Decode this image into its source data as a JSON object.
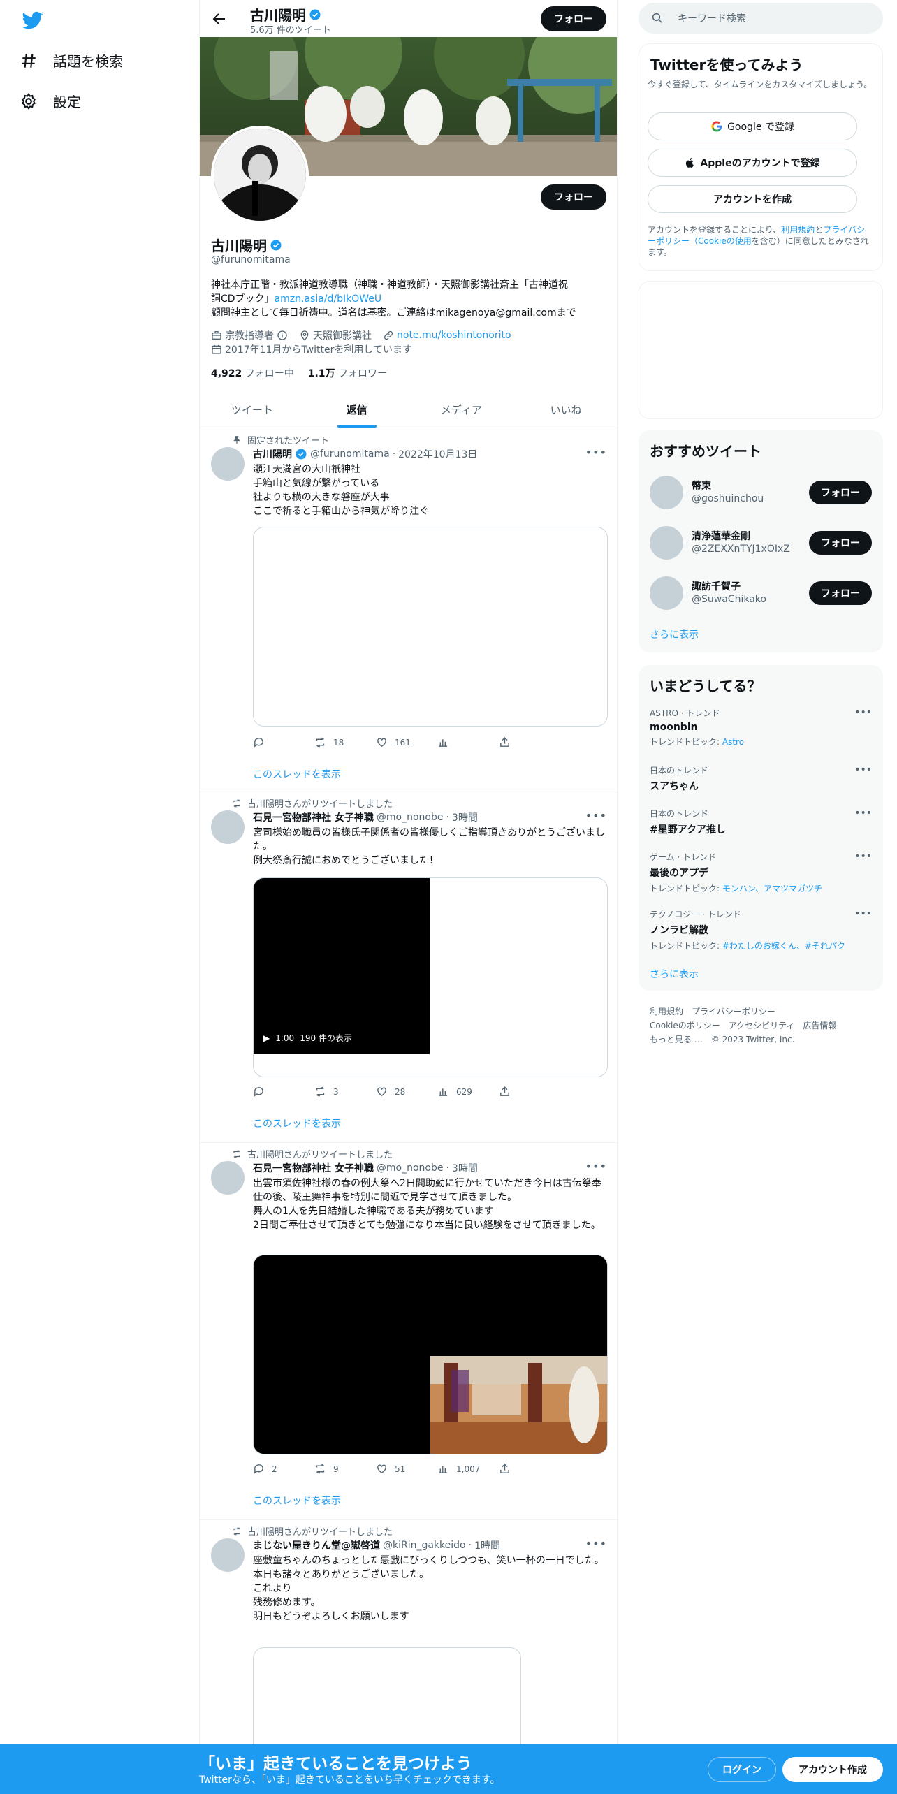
{
  "nav": {
    "explore": "話題を検索",
    "settings": "設定"
  },
  "header": {
    "name": "古川陽明",
    "tweet_count": "5.6万 件のツイート",
    "follow": "フォロー"
  },
  "profile": {
    "name": "古川陽明",
    "handle": "@furunomitama",
    "follow": "フォロー",
    "bio_line1": "神社本庁正階・教派神道教導職（神職・神道教師）・天照御影講社斎主「古神道祝",
    "bio_line2_text": "詞CDブック」",
    "bio_link": "amzn.asia/d/bIkOWeU",
    "bio_line3": "顧問神主として毎日祈祷中。道名は基密。ご連絡はmikagenoya@gmail.comまで",
    "category": "宗教指導者",
    "location": "天照御影講社",
    "website": "note.mu/koshintonorito",
    "joined": "2017年11月からTwitterを利用しています",
    "following_count": "4,922",
    "following_label": "フォロー中",
    "followers_count": "1.1万",
    "followers_label": "フォロワー"
  },
  "tabs": [
    "ツイート",
    "返信",
    "メディア",
    "いいね"
  ],
  "tweets": [
    {
      "context": "固定されたツイート",
      "name": "古川陽明",
      "handle": "@furunomitama",
      "time": "2022年10月13日",
      "text": "瀬江天満宮の大山祇神社\n手箱山と気線が繋がっている\n社よりも横の大きな磐座が大事\nここで祈ると手箱山から神気が降り注ぐ",
      "reply": "",
      "retweet": "18",
      "like": "161",
      "views": "",
      "thread": "このスレッドを表示"
    },
    {
      "context": "古川陽明さんがリツイートしました",
      "name": "石見一宮物部神社 女子神職",
      "handle": "@mo_nonobe",
      "time": "3時間",
      "text": "宮司様始め職員の皆様氏子関係者の皆様優しくご指導頂きありがとうございました。\n例大祭斎行誠におめでとうございました！",
      "video_time": "1:00",
      "video_views": "190 件の表示",
      "reply": "",
      "retweet": "3",
      "like": "28",
      "views": "629",
      "thread": "このスレッドを表示"
    },
    {
      "context": "古川陽明さんがリツイートしました",
      "name": "石見一宮物部神社 女子神職",
      "handle": "@mo_nonobe",
      "time": "3時間",
      "text": "出雲市須佐神社様の春の例大祭へ2日間助勤に行かせていただき今日は古伝祭奉仕の後、陵王舞神事を特別に間近で見学させて頂きました。\n舞人の1人を先日結婚した神職である夫が務めています\n2日間ご奉仕させて頂きとても勉強になり本当に良い経験をさせて頂きました。",
      "reply": "2",
      "retweet": "9",
      "like": "51",
      "views": "1,007",
      "thread": "このスレッドを表示"
    },
    {
      "context": "古川陽明さんがリツイートしました",
      "name": "まじない屋きりん堂@嶽啓道",
      "handle": "@kiRin_gakkeido",
      "time": "1時間",
      "text": "座敷童ちゃんのちょっとした悪戯にびっくりしつつも、笑い一杯の一日でした。\n本日も諸々とありがとうございました。\nこれより\n残務修めます。\n明日もどうぞよろしくお願いします"
    }
  ],
  "search": {
    "placeholder": "キーワード検索"
  },
  "signup": {
    "title": "Twitterを使ってみよう",
    "subtitle": "今すぐ登録して、タイムラインをカスタマイズしましょう。",
    "google": "Google で登録",
    "apple": "Appleのアカウントで登録",
    "create": "アカウントを作成",
    "terms_1": "アカウントを登録することにより、",
    "terms_link1": "利用規約",
    "terms_2": "と",
    "terms_link2": "プライバシーポリシー（Cookieの使用",
    "terms_3": "を含む）に同意したとみなされます。"
  },
  "recommend": {
    "title": "おすすめツイート",
    "users": [
      {
        "name": "幣束",
        "handle": "@goshuinchou",
        "follow": "フォロー"
      },
      {
        "name": "清浄蓮華金剛",
        "handle": "@2ZEXXnTYJ1xOIxZ",
        "follow": "フォロー"
      },
      {
        "name": "諏訪千賀子",
        "handle": "@SuwaChikako",
        "follow": "フォロー"
      }
    ],
    "more": "さらに表示"
  },
  "trends": {
    "title": "いまどうしてる？",
    "items": [
      {
        "category": "ASTRO · トレンド",
        "title": "moonbin",
        "topic_label": "トレンドトピック: ",
        "topic": "Astro"
      },
      {
        "category": "日本のトレンド",
        "title": "スアちゃん",
        "topic_label": "",
        "topic": ""
      },
      {
        "category": "日本のトレンド",
        "title": "#星野アクア推し",
        "topic_label": "",
        "topic": ""
      },
      {
        "category": "ゲーム · トレンド",
        "title": "最後のアプデ",
        "topic_label": "トレンドトピック: ",
        "topic": "モンハン、アマツマガツチ"
      },
      {
        "category": "テクノロジー · トレンド",
        "title": "ノンラビ解散",
        "topic_label": "トレンドトピック: ",
        "topic": "#わたしのお嫁くん、#それパク"
      }
    ],
    "more": "さらに表示"
  },
  "footer": {
    "line1": "利用規約　プライバシーポリシー",
    "line2": "Cookieのポリシー　アクセシビリティ　広告情報",
    "line3": "もっと見る …　© 2023 Twitter, Inc."
  },
  "bottom": {
    "title": "「いま」起きていることを見つけよう",
    "subtitle": "Twitterなら、「いま」起きていることをいち早くチェックできます。",
    "login": "ログイン",
    "signup": "アカウント作成"
  },
  "colors": {
    "accent": "#1d9bf0",
    "text": "#0f1419",
    "muted": "#536471"
  }
}
